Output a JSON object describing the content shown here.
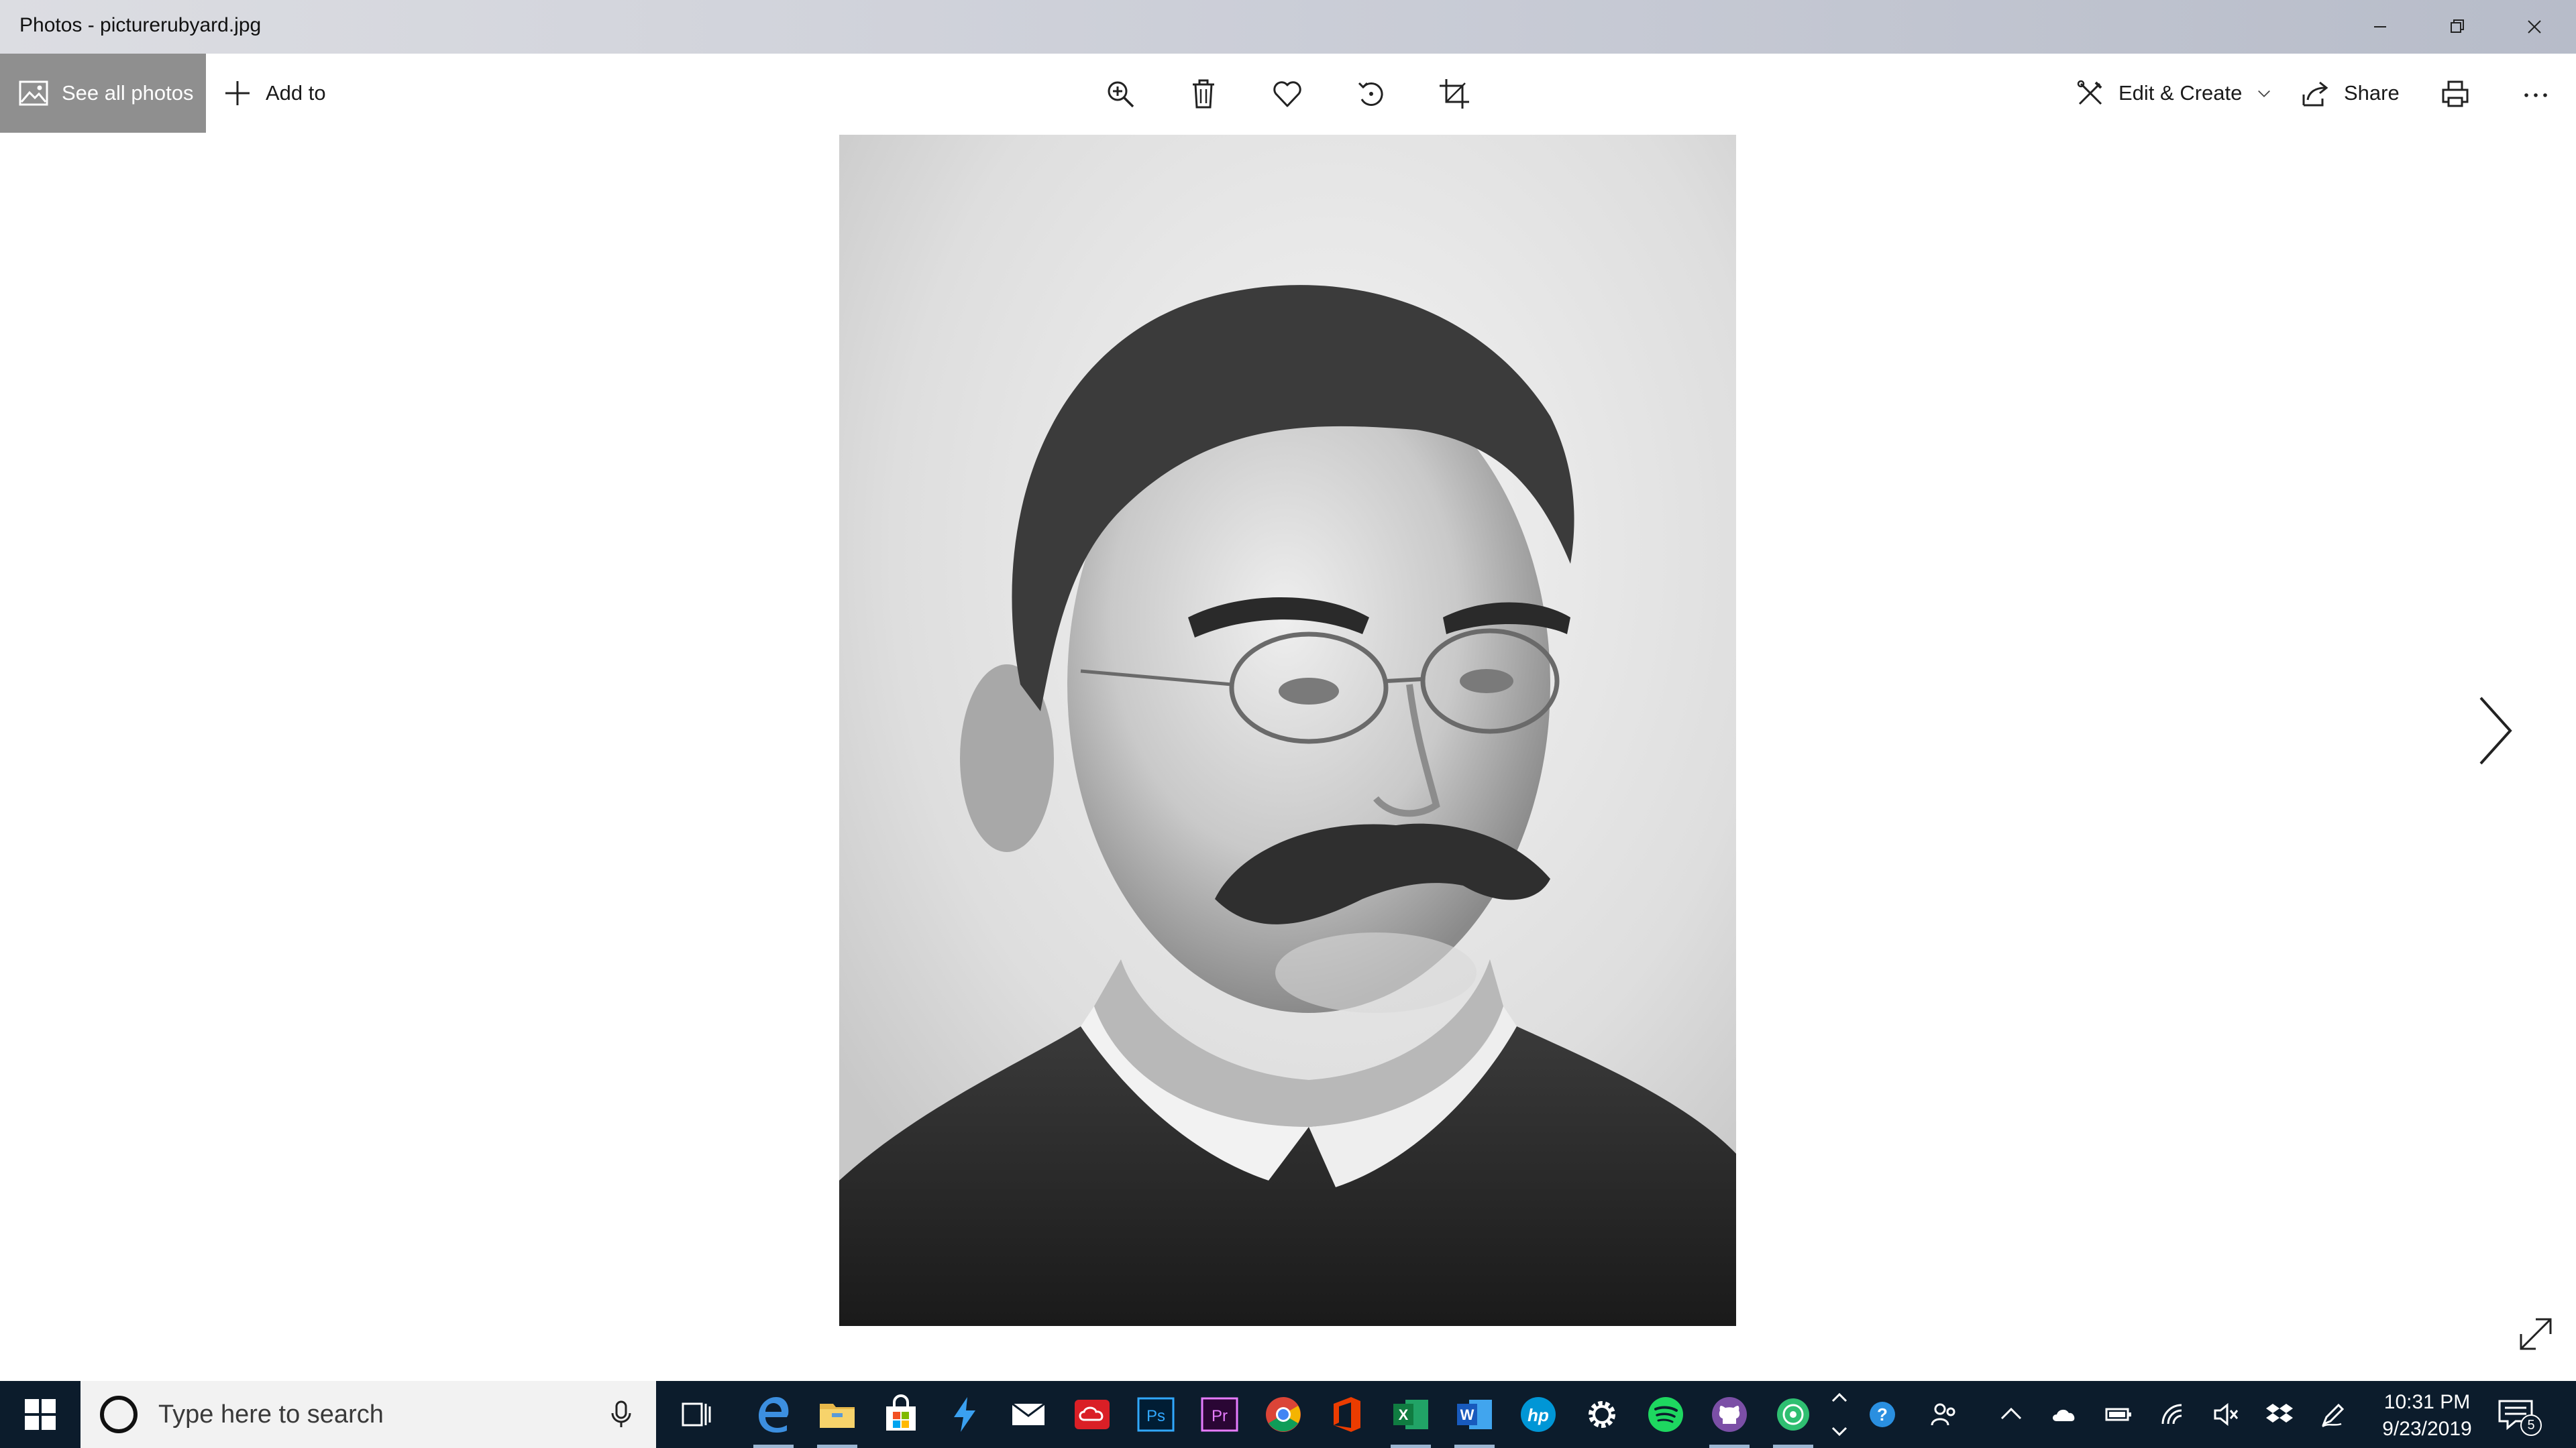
{
  "window": {
    "title": "Photos - picturerubyard.jpg",
    "controls": [
      "minimize-icon",
      "restore-icon",
      "close-icon"
    ]
  },
  "toolbar": {
    "see_all_label": "See all photos",
    "add_to_label": "Add to",
    "tools": [
      "zoom-in-icon",
      "delete-icon",
      "favorite-heart-icon",
      "rotate-icon",
      "crop-icon"
    ],
    "edit_create_label": "Edit & Create",
    "share_label": "Share",
    "print_icon": "print-icon",
    "more_icon": "more-ellipsis-icon"
  },
  "viewer": {
    "photo_description_icon": "portrait-photo",
    "next_icon": "chevron-right-icon",
    "fullscreen_icon": "expand-diagonal-icon"
  },
  "taskbar": {
    "search_placeholder": "Type here to search",
    "apps": [
      "task-view",
      "edge",
      "file-explorer",
      "store",
      "visual-studio",
      "mail",
      "creative-cloud",
      "photoshop",
      "premiere",
      "chrome",
      "office",
      "excel",
      "word",
      "hp",
      "settings",
      "spotify",
      "github",
      "app-green"
    ],
    "tray": [
      "help",
      "people",
      "show-hidden",
      "onedrive",
      "battery",
      "wifi",
      "mute",
      "dropbox",
      "pen"
    ],
    "time": "10:31 PM",
    "date": "9/23/2019",
    "notification_count": "5"
  },
  "colors": {
    "see_all_bg": "#8f8f8f",
    "taskbar_bg": "#0c1c2c",
    "search_bg": "#f2f2f2"
  }
}
